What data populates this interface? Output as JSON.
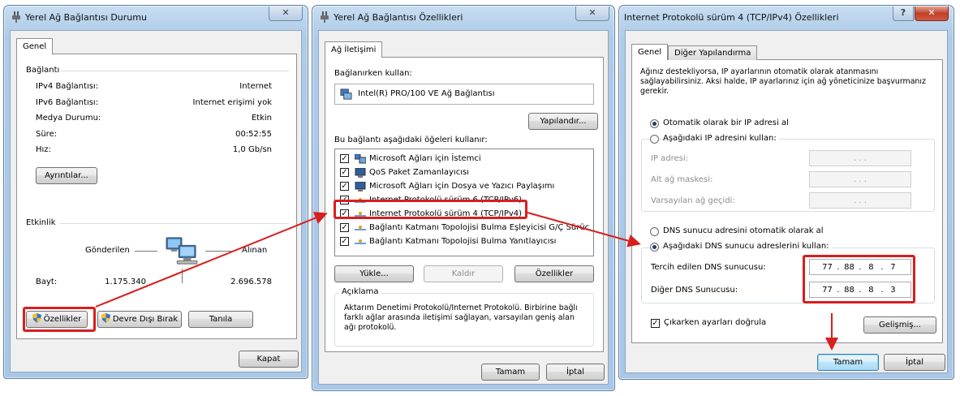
{
  "colors": {
    "annotation_red": "#d81e1e",
    "title_bar": "#b9d3ec",
    "default_button": "#bee6fd"
  },
  "window1": {
    "title": "Yerel Ağ Bağlantısı Durumu",
    "close": "✕",
    "tab": "Genel",
    "connection_header": "Bağlantı",
    "rows": [
      {
        "label": "IPv4 Bağlantısı:",
        "value": "Internet"
      },
      {
        "label": "IPv6 Bağlantısı:",
        "value": "Internet erişimi yok"
      },
      {
        "label": "Medya Durumu:",
        "value": "Etkin"
      },
      {
        "label": "Süre:",
        "value": "00:52:55"
      },
      {
        "label": "Hız:",
        "value": "1,0 Gb/sn"
      }
    ],
    "details_button": "Ayrıntılar...",
    "activity_header": "Etkinlik",
    "sent_label": "Gönderilen",
    "received_label": "Alınan",
    "bytes_label": "Bayt:",
    "bytes_sent": "1.175.340",
    "bytes_received": "2.696.578",
    "properties_button": "Özellikler",
    "disable_button": "Devre Dışı Bırak",
    "diagnose_button": "Tanıla",
    "close_button": "Kapat"
  },
  "window2": {
    "title": "Yerel Ağ Bağlantısı Özellikleri",
    "close": "✕",
    "tab": "Ağ İletişimi",
    "connect_using_label": "Bağlanırken kullan:",
    "adapter": "Intel(R) PRO/100 VE Ağ Bağlantısı",
    "configure_button": "Yapılandır...",
    "items_label": "Bu bağlantı aşağıdaki öğeleri kullanır:",
    "items": [
      {
        "label": "Microsoft Ağları için İstemci",
        "checked": true,
        "icon": "network-client-icon"
      },
      {
        "label": "QoS Paket Zamanlayıcısı",
        "checked": true,
        "icon": "qos-scheduler-icon"
      },
      {
        "label": "Microsoft Ağları için Dosya ve Yazıcı Paylaşımı",
        "checked": true,
        "icon": "file-printer-sharing-icon"
      },
      {
        "label": "Internet Protokolü sürüm 6 (TCP/IPv6)",
        "checked": true,
        "icon": "protocol-icon"
      },
      {
        "label": "Internet Protokolü sürüm 4 (TCP/IPv4)",
        "checked": true,
        "icon": "protocol-icon"
      },
      {
        "label": "Bağlantı Katmanı Topolojisi Bulma Eşleyicisi G/Ç Sürücü...",
        "checked": true,
        "icon": "protocol-icon"
      },
      {
        "label": "Bağlantı Katmanı Topolojisi Bulma Yanıtlayıcısı",
        "checked": true,
        "icon": "protocol-icon"
      }
    ],
    "install_button": "Yükle...",
    "uninstall_button": "Kaldır",
    "properties_button": "Özellikler",
    "description_legend": "Açıklama",
    "description_text": "Aktarım Denetimi Protokolü/Internet Protokolü. Birbirine bağlı farklı ağlar arasında iletişimi sağlayan, varsayılan geniş alan ağı protokolü.",
    "ok_button": "Tamam",
    "cancel_button": "İptal"
  },
  "window3": {
    "title": "Internet Protokolü sürüm 4 (TCP/IPv4) Özellikleri",
    "help": "?",
    "close": "✕",
    "tab_general": "Genel",
    "tab_alternate": "Diğer Yapılandırma",
    "intro": "Ağınız destekliyorsa, IP ayarlarının otomatik olarak atanmasını sağlayabilirsiniz. Aksi halde, IP ayarlarınız için ağ yöneticinize başvurmanız gerekir.",
    "radio_auto_ip": "Otomatik olarak bir IP adresi al",
    "radio_manual_ip": "Aşağıdaki IP adresini kullan:",
    "ip_address_label": "IP adresi:",
    "subnet_label": "Alt ağ maskesi:",
    "gateway_label": "Varsayılan ağ geçidi:",
    "empty_ip_dots": ".   .   .",
    "radio_auto_dns": "DNS sunucu adresini otomatik olarak al",
    "radio_manual_dns": "Aşağıdaki DNS sunucu adreslerini kullan:",
    "preferred_dns_label": "Tercih edilen DNS sunucusu:",
    "alternate_dns_label": "Diğer DNS Sunucusu:",
    "preferred_dns": [
      "77",
      "88",
      "8",
      "7"
    ],
    "alternate_dns": [
      "77",
      "88",
      "8",
      "3"
    ],
    "validate_checkbox": "Çıkarken ayarları doğrula",
    "advanced_button": "Gelişmiş...",
    "ok_button": "Tamam",
    "cancel_button": "İptal"
  }
}
